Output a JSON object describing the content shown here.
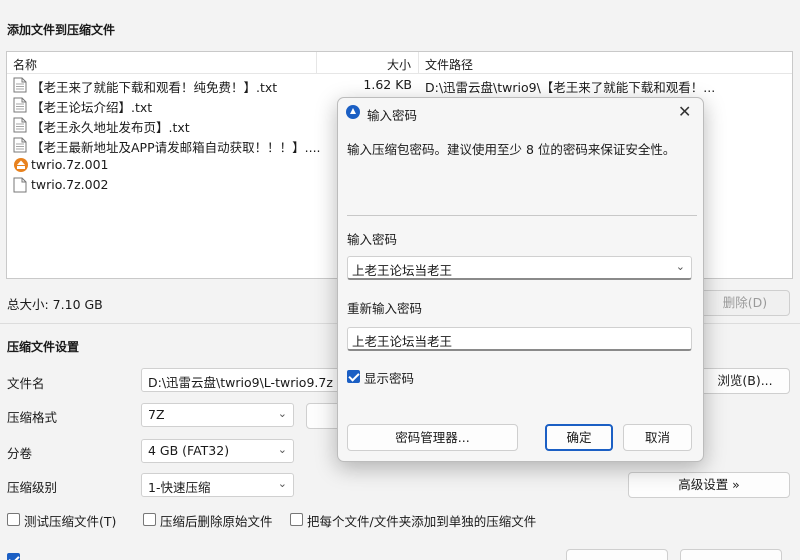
{
  "main": {
    "section_add_files": "添加文件到压缩文件",
    "columns": {
      "name": "名称",
      "size": "大小",
      "path": "文件路径"
    },
    "files": [
      {
        "name": "【老王来了就能下载和观看！纯免费！】.txt",
        "size": "1.62 KB",
        "path": "D:\\迅雷云盘\\twrio9\\【老王来了就能下载和观看！...",
        "icon": "text-file-icon"
      },
      {
        "name": "【老王论坛介绍】.txt",
        "size": "",
        "path": "",
        "icon": "text-file-icon"
      },
      {
        "name": "【老王永久地址发布页】.txt",
        "size": "",
        "path": "",
        "icon": "text-file-icon"
      },
      {
        "name": "【老王最新地址及APP请发邮箱自动获取！！！】....",
        "size": "",
        "path": "",
        "icon": "text-file-icon"
      },
      {
        "name": "twrio.7z.001",
        "size": "",
        "path": "",
        "icon": "archive-icon"
      },
      {
        "name": "twrio.7z.002",
        "size": "",
        "path": "",
        "icon": "blank-file-icon"
      }
    ],
    "total_size": "总大小: 7.10 GB",
    "delete_button": "删除(D)",
    "section_settings": "压缩文件设置",
    "filename_label": "文件名",
    "filename_value": "D:\\迅雷云盘\\twrio9\\L-twrio9.7z",
    "browse_button": "浏览(B)...",
    "format_label": "压缩格式",
    "format_value": "7Z",
    "volume_label": "分卷",
    "volume_value": "4 GB (FAT32)",
    "level_label": "压缩级别",
    "level_value": "1-快速压缩",
    "advanced_button": "高级设置 »",
    "opt_test": "测试压缩文件(T)",
    "opt_delete": "压缩后删除原始文件",
    "opt_separate": "把每个文件/文件夹添加到单独的压缩文件"
  },
  "dialog": {
    "title": "输入密码",
    "description": "输入压缩包密码。建议使用至少 8 位的密码来保证安全性。",
    "password_label": "输入密码",
    "password_value": "上老王论坛当老王",
    "confirm_label": "重新输入密码",
    "confirm_value": "上老王论坛当老王",
    "show_password": "显示密码",
    "show_password_checked": true,
    "manager_button": "密码管理器...",
    "ok_button": "确定",
    "cancel_button": "取消"
  },
  "colors": {
    "accent": "#1b5fc4",
    "background": "#f3f3f3"
  }
}
